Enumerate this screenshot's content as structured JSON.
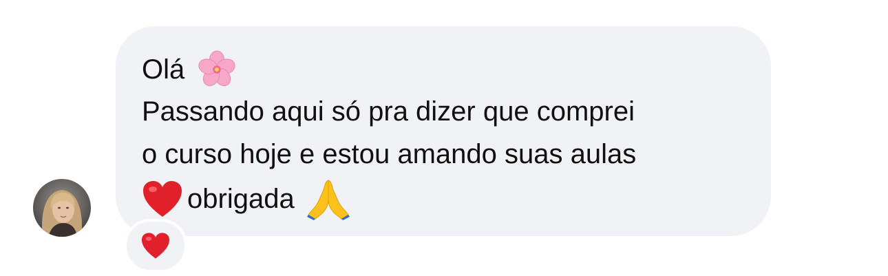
{
  "message": {
    "greeting": "Olá",
    "greeting_emoji": "cherry-blossom-icon",
    "line2": "Passando aqui só pra dizer que comprei",
    "line3": "o curso hoje e estou amando suas aulas",
    "line4": "obrigada",
    "line4_leading_emoji": "red-heart-icon",
    "line4_trailing_emoji": "folded-hands-icon"
  },
  "reaction": {
    "emoji": "red-heart-icon"
  },
  "colors": {
    "bubble": "#f1f2f5",
    "text": "#101010",
    "heart": "#e0202a"
  }
}
